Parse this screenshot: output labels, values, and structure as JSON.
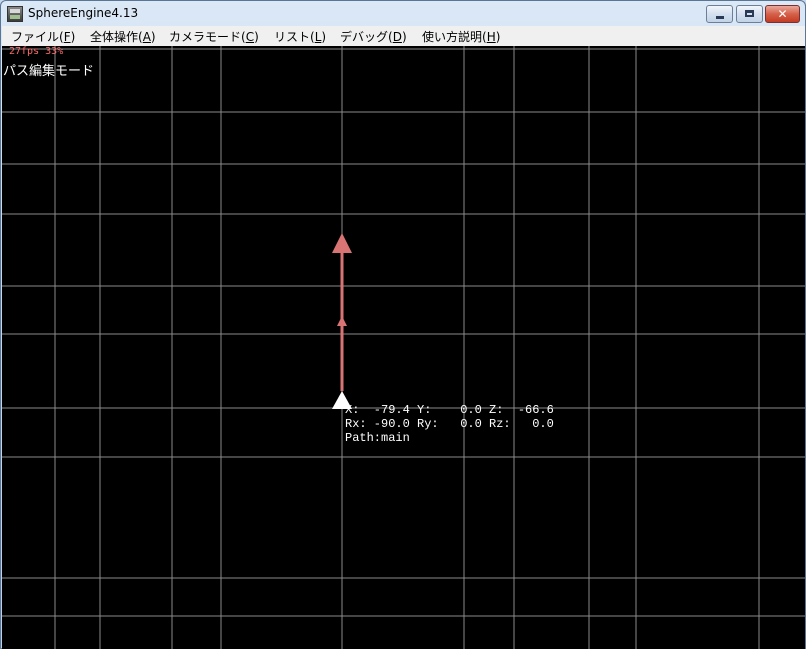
{
  "window": {
    "title": "SphereEngine4.13",
    "close_glyph": "✕"
  },
  "menu": [
    {
      "label": "ファイル(",
      "key": "F",
      "tail": ")"
    },
    {
      "label": "全体操作(",
      "key": "A",
      "tail": ")"
    },
    {
      "label": "カメラモード(",
      "key": "C",
      "tail": ")"
    },
    {
      "label": "リスト(",
      "key": "L",
      "tail": ")"
    },
    {
      "label": "デバッグ(",
      "key": "D",
      "tail": ")"
    },
    {
      "label": "使い方説明(",
      "key": "H",
      "tail": ")"
    }
  ],
  "hud": {
    "fps": "27fps  33%",
    "mode": "パス編集モード"
  },
  "object": {
    "line1": "X:  -79.4 Y:    0.0 Z:  -66.6",
    "line2": "Rx: -90.0 Ry:   0.0 Rz:   0.0",
    "line3": "Path:main"
  },
  "colors": {
    "grid": "#8a8a8a",
    "arrow": "#d97474",
    "marker": "#ffffff"
  }
}
